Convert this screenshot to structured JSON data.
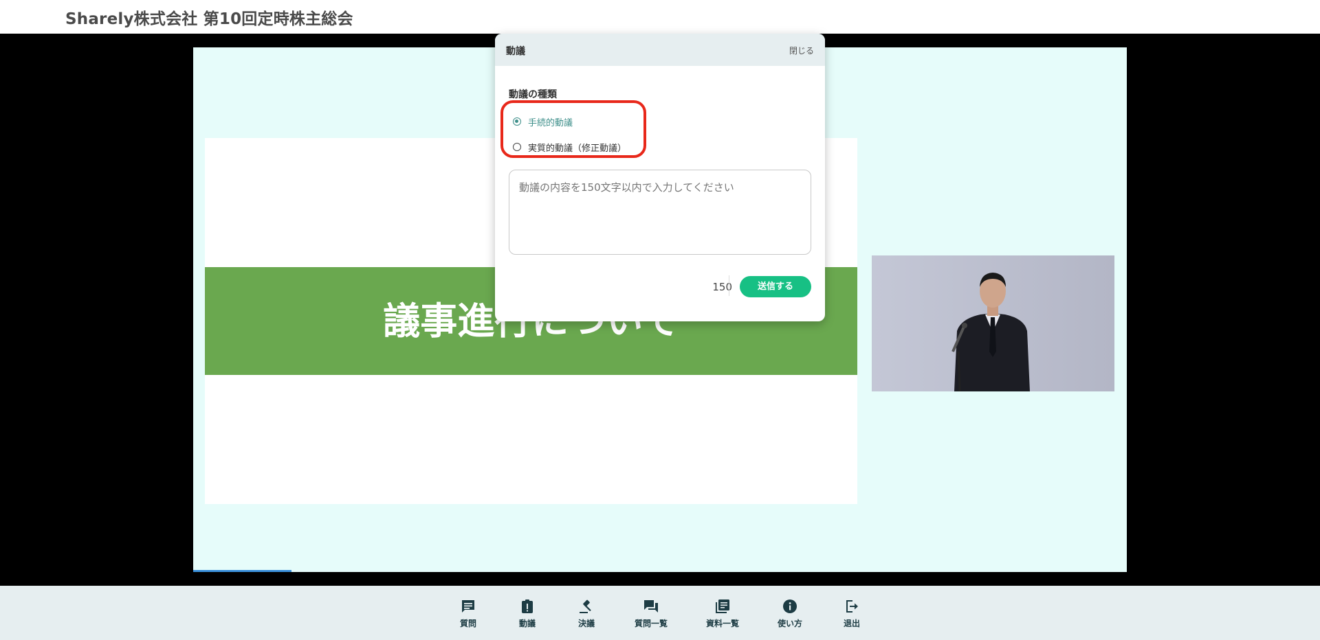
{
  "header": {
    "title": "Sharely株式会社 第10回定時株主総会"
  },
  "slide": {
    "heading": "議事進行について"
  },
  "toolbar": {
    "items": [
      {
        "label": "質問",
        "icon": "question-comment-icon"
      },
      {
        "label": "動議",
        "icon": "motion-clipboard-icon"
      },
      {
        "label": "決議",
        "icon": "gavel-icon"
      },
      {
        "label": "質問一覧",
        "icon": "question-list-icon"
      },
      {
        "label": "資料一覧",
        "icon": "documents-icon"
      },
      {
        "label": "使い方",
        "icon": "info-icon"
      },
      {
        "label": "退出",
        "icon": "exit-icon"
      }
    ]
  },
  "modal": {
    "title": "動議",
    "close_label": "閉じる",
    "type_label": "動議の種類",
    "options": [
      {
        "label": "手続的動議",
        "selected": true
      },
      {
        "label": "実質的動議（修正動議）",
        "selected": false
      }
    ],
    "placeholder": "動議の内容を150文字以内で入力してください",
    "counter": "150",
    "submit_label": "送信する"
  },
  "colors": {
    "accent": "#17c084",
    "band": "#6aa84f",
    "highlight": "#e8281a",
    "screen_bg": "#e6fcfa"
  }
}
